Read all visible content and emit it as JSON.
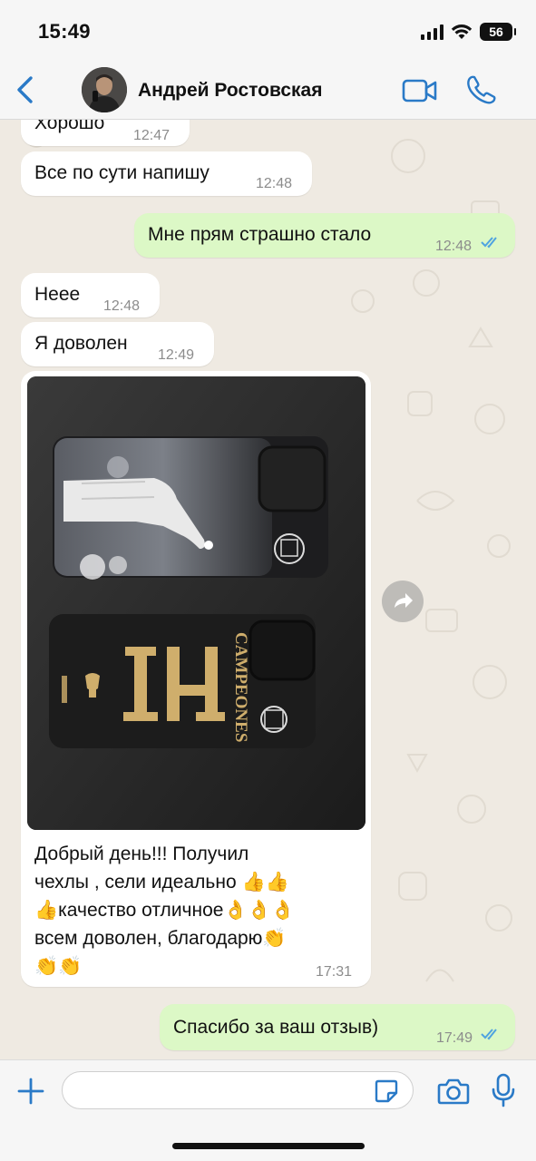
{
  "status_bar": {
    "time": "15:49",
    "battery": "56"
  },
  "header": {
    "contact_name": "Андрей Ростовская"
  },
  "messages": [
    {
      "direction": "in",
      "text": "Хорошо",
      "time": "12:47"
    },
    {
      "direction": "in",
      "text": "Все по сути напишу",
      "time": "12:48"
    },
    {
      "direction": "out",
      "text": "Мне прям страшно стало",
      "time": "12:48",
      "status": "read"
    },
    {
      "direction": "in",
      "text": "Неее",
      "time": "12:48"
    },
    {
      "direction": "in",
      "text": "Я доволен",
      "time": "12:49"
    },
    {
      "direction": "in",
      "type": "photo",
      "caption_lines": [
        "Добрый день!!! Получил",
        "чехлы , сели идеально 👍👍",
        "👍качество отличное👌👌👌",
        "всем доволен, благодарю👏",
        "👏👏"
      ],
      "time": "17:31",
      "photo_text": {
        "number": "14",
        "word": "CAMPEONES"
      }
    },
    {
      "direction": "out",
      "text": "Спасибо за ваш отзыв)",
      "time": "17:49",
      "status": "read"
    }
  ],
  "input": {
    "placeholder": ""
  },
  "colors": {
    "accent": "#2a7ac7",
    "outgoing_bubble": "#dcf8c6",
    "incoming_bubble": "#ffffff",
    "read_ticks": "#4fa3e0"
  }
}
